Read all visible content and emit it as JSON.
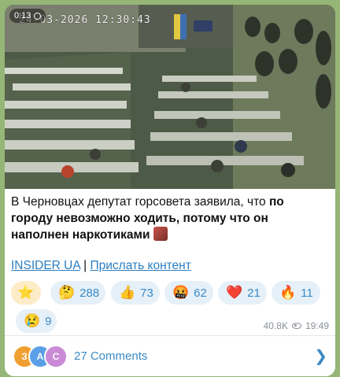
{
  "video": {
    "duration": "0:13",
    "osd_timestamp": "24-03-2026 12:30:43"
  },
  "caption": {
    "plain": "В Черновцах депутат горсовета заявила, что ",
    "bold": "по городу невозможно ходить, потому что он наполнен наркотиками"
  },
  "links": {
    "channel": "INSIDER UA",
    "separator": "|",
    "submit": "Прислать контент"
  },
  "reactions": [
    {
      "emoji": "⭐",
      "count": ""
    },
    {
      "emoji": "🤔",
      "count": "288"
    },
    {
      "emoji": "👍",
      "count": "73"
    },
    {
      "emoji": "🤬",
      "count": "62"
    },
    {
      "emoji": "❤️",
      "count": "21"
    },
    {
      "emoji": "🔥",
      "count": "11"
    },
    {
      "emoji": "😢",
      "count": "9"
    }
  ],
  "meta": {
    "views": "40.8K",
    "time": "19:49"
  },
  "comments": {
    "label": "27 Comments",
    "avatars": [
      {
        "letter": "З",
        "color": "#f0a030"
      },
      {
        "letter": "A",
        "color": "#5ba0e6"
      },
      {
        "letter": "C",
        "color": "#c98bd6"
      }
    ]
  }
}
